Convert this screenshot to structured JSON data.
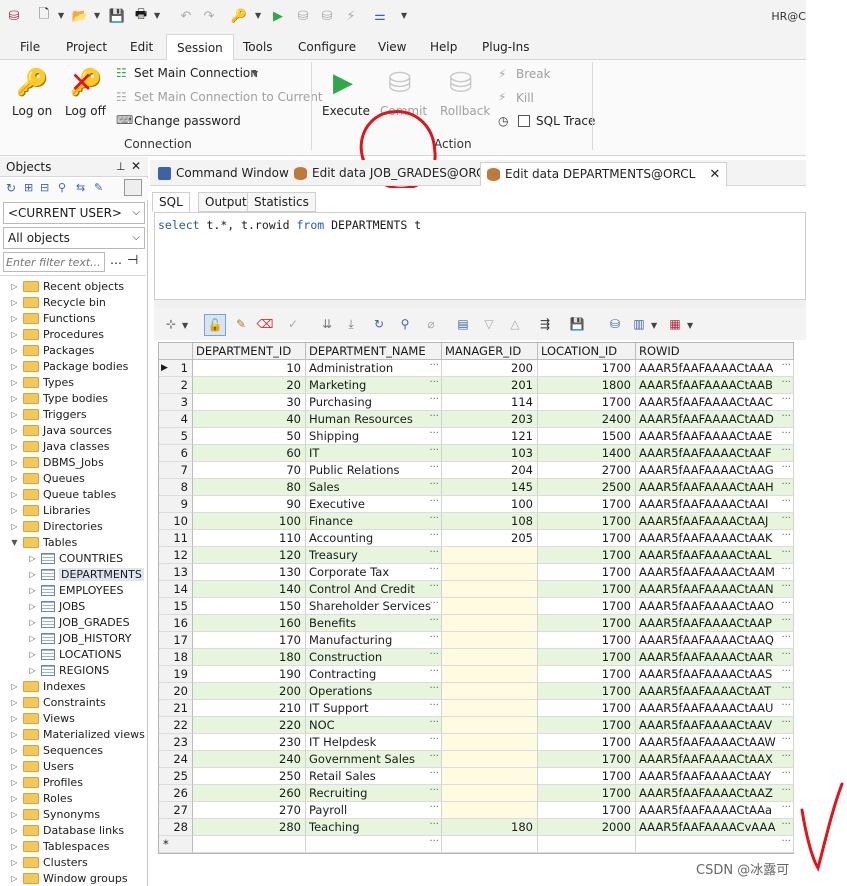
{
  "quickbar": {
    "title_right": "HR@C"
  },
  "menu": [
    "File",
    "Project",
    "Edit",
    "Session",
    "Tools",
    "Configure",
    "View",
    "Help",
    "Plug-Ins"
  ],
  "menu_active_index": 3,
  "ribbon": {
    "logon": "Log on",
    "logoff": "Log off",
    "set_main_connection": "Set Main Connection",
    "set_main_connection_current": "Set Main Connection to Current",
    "change_password": "Change password",
    "connection_group": "Connection",
    "execute": "Execute",
    "commit": "Commit",
    "rollback": "Rollback",
    "break": "Break",
    "kill": "Kill",
    "sql_trace": "SQL Trace",
    "action_group": "Action"
  },
  "left": {
    "objects_label": "Objects",
    "user_combo": "<CURRENT USER>",
    "objects_combo": "All objects",
    "filter_placeholder": "Enter filter text...",
    "tree": [
      "Recent objects",
      "Recycle bin",
      "Functions",
      "Procedures",
      "Packages",
      "Package bodies",
      "Types",
      "Type bodies",
      "Triggers",
      "Java sources",
      "Java classes",
      "DBMS_Jobs",
      "Queues",
      "Queue tables",
      "Libraries",
      "Directories",
      "Tables"
    ],
    "tables": [
      "COUNTRIES",
      "DEPARTMENTS",
      "EMPLOYEES",
      "JOBS",
      "JOB_GRADES",
      "JOB_HISTORY",
      "LOCATIONS",
      "REGIONS"
    ],
    "tree_after": [
      "Indexes",
      "Constraints",
      "Views",
      "Materialized views",
      "Sequences",
      "Users",
      "Profiles",
      "Roles",
      "Synonyms",
      "Database links",
      "Tablespaces",
      "Clusters",
      "Window groups"
    ]
  },
  "tabs": {
    "command_window": "Command Window",
    "edit_job_grades": "Edit data JOB_GRADES@ORCL",
    "edit_departments": "Edit data DEPARTMENTS@ORCL",
    "close": "✕"
  },
  "subtabs": [
    "SQL",
    "Output",
    "Statistics"
  ],
  "sql": {
    "select": "select",
    "mid": " t.*, t.rowid ",
    "from": "from",
    "tail": " DEPARTMENTS t"
  },
  "grid": {
    "columns": [
      "DEPARTMENT_ID",
      "DEPARTMENT_NAME",
      "MANAGER_ID",
      "LOCATION_ID",
      "ROWID"
    ],
    "rows": [
      [
        "10",
        "Administration",
        "200",
        "1700",
        "AAAR5fAAFAAAACtAAA"
      ],
      [
        "20",
        "Marketing",
        "201",
        "1800",
        "AAAR5fAAFAAAACtAAB"
      ],
      [
        "30",
        "Purchasing",
        "114",
        "1700",
        "AAAR5fAAFAAAACtAAC"
      ],
      [
        "40",
        "Human Resources",
        "203",
        "2400",
        "AAAR5fAAFAAAACtAAD"
      ],
      [
        "50",
        "Shipping",
        "121",
        "1500",
        "AAAR5fAAFAAAACtAAE"
      ],
      [
        "60",
        "IT",
        "103",
        "1400",
        "AAAR5fAAFAAAACtAAF"
      ],
      [
        "70",
        "Public Relations",
        "204",
        "2700",
        "AAAR5fAAFAAAACtAAG"
      ],
      [
        "80",
        "Sales",
        "145",
        "2500",
        "AAAR5fAAFAAAACtAAH"
      ],
      [
        "90",
        "Executive",
        "100",
        "1700",
        "AAAR5fAAFAAAACtAAI"
      ],
      [
        "100",
        "Finance",
        "108",
        "1700",
        "AAAR5fAAFAAAACtAAJ"
      ],
      [
        "110",
        "Accounting",
        "205",
        "1700",
        "AAAR5fAAFAAAACtAAK"
      ],
      [
        "120",
        "Treasury",
        "",
        "1700",
        "AAAR5fAAFAAAACtAAL"
      ],
      [
        "130",
        "Corporate Tax",
        "",
        "1700",
        "AAAR5fAAFAAAACtAAM"
      ],
      [
        "140",
        "Control And Credit",
        "",
        "1700",
        "AAAR5fAAFAAAACtAAN"
      ],
      [
        "150",
        "Shareholder Services",
        "",
        "1700",
        "AAAR5fAAFAAAACtAAO"
      ],
      [
        "160",
        "Benefits",
        "",
        "1700",
        "AAAR5fAAFAAAACtAAP"
      ],
      [
        "170",
        "Manufacturing",
        "",
        "1700",
        "AAAR5fAAFAAAACtAAQ"
      ],
      [
        "180",
        "Construction",
        "",
        "1700",
        "AAAR5fAAFAAAACtAAR"
      ],
      [
        "190",
        "Contracting",
        "",
        "1700",
        "AAAR5fAAFAAAACtAAS"
      ],
      [
        "200",
        "Operations",
        "",
        "1700",
        "AAAR5fAAFAAAACtAAT"
      ],
      [
        "210",
        "IT Support",
        "",
        "1700",
        "AAAR5fAAFAAAACtAAU"
      ],
      [
        "220",
        "NOC",
        "",
        "1700",
        "AAAR5fAAFAAAACtAAV"
      ],
      [
        "230",
        "IT Helpdesk",
        "",
        "1700",
        "AAAR5fAAFAAAACtAAW"
      ],
      [
        "240",
        "Government Sales",
        "",
        "1700",
        "AAAR5fAAFAAAACtAAX"
      ],
      [
        "250",
        "Retail Sales",
        "",
        "1700",
        "AAAR5fAAFAAAACtAAY"
      ],
      [
        "260",
        "Recruiting",
        "",
        "1700",
        "AAAR5fAAFAAAACtAAZ"
      ],
      [
        "270",
        "Payroll",
        "",
        "1700",
        "AAAR5fAAFAAAACtAAa"
      ],
      [
        "280",
        "Teaching",
        "180",
        "2000",
        "AAAR5fAAFAAAACvAAA"
      ]
    ],
    "new_row_marker": "*"
  },
  "watermark": "CSDN @冰露可",
  "colors": {
    "row_alt": "#e6f5dc",
    "null_cell": "#fffbe1",
    "annotation": "#e0141b"
  }
}
